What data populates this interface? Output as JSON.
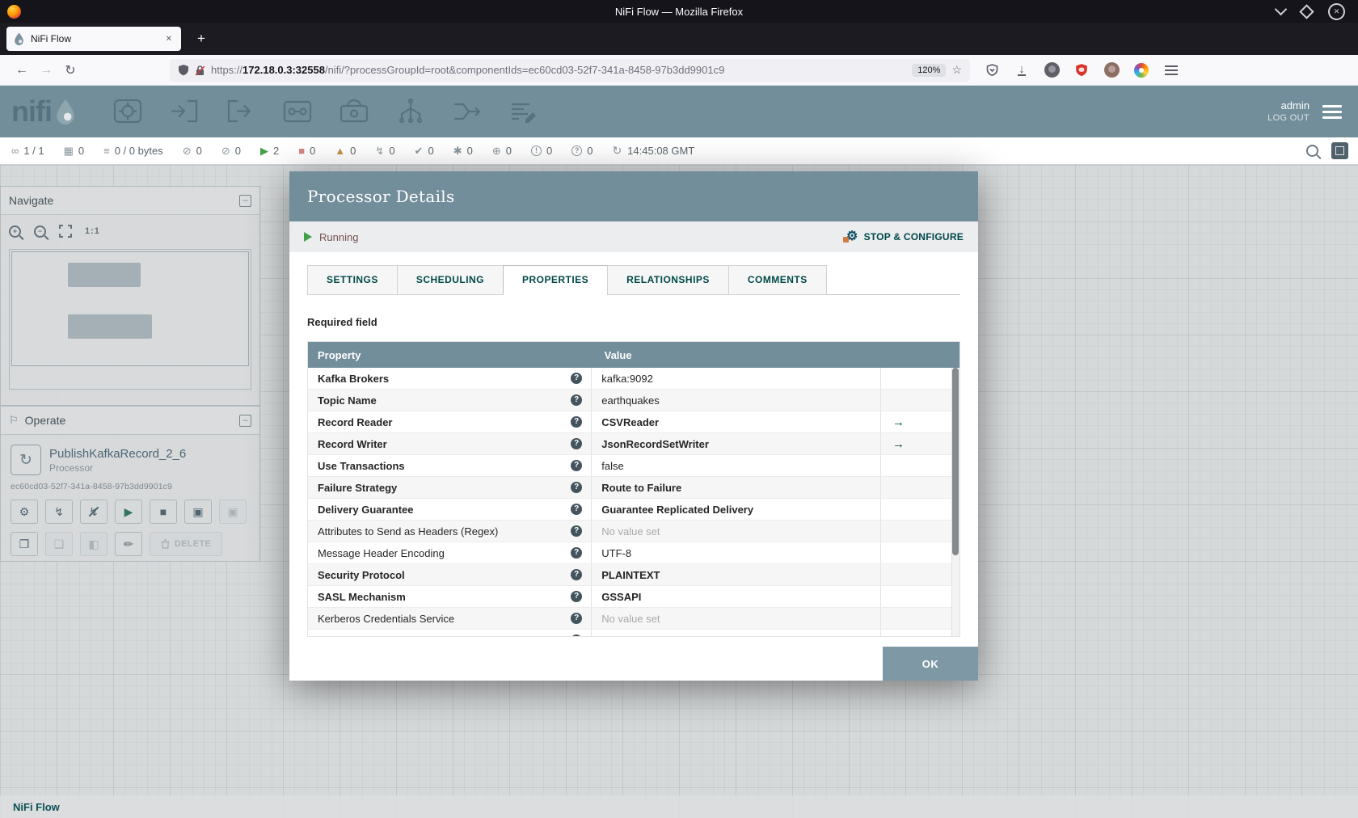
{
  "colors": {
    "nifi_header": "#728e9b",
    "primary_teal": "#004849",
    "running_green": "#43a047",
    "stopped_red": "#d18686",
    "invalid_amber": "#bf9046",
    "unset_gray": "#a9a9a9",
    "table_header": "#728e9b",
    "firefox_titlebar": "#15141a"
  },
  "titlebar": {
    "title": "NiFi Flow — Mozilla Firefox"
  },
  "tab": {
    "title": "NiFi Flow"
  },
  "navbar": {
    "url_protocol": "https://",
    "url_host": "172.18.0.3:32558",
    "url_path": "/nifi/?processGroupId=root&componentIds=ec60cd03-52f7-341a-8458-97b3dd9901c9",
    "zoom_badge": "120%"
  },
  "header": {
    "logo_text": "nifi",
    "username": "admin",
    "logout_label": "LOG OUT"
  },
  "statusbar": {
    "items": [
      {
        "icon": "cluster",
        "value": "1 / 1"
      },
      {
        "icon": "threads",
        "value": "0"
      },
      {
        "icon": "queue",
        "value": "0 / 0 bytes"
      },
      {
        "icon": "transmitting",
        "value": "0"
      },
      {
        "icon": "not-transmitting",
        "value": "0"
      },
      {
        "icon": "running",
        "value": "2"
      },
      {
        "icon": "stopped",
        "value": "0"
      },
      {
        "icon": "invalid",
        "value": "0"
      },
      {
        "icon": "disabled",
        "value": "0"
      },
      {
        "icon": "up-to-date",
        "value": "0"
      },
      {
        "icon": "locally-modified",
        "value": "0"
      },
      {
        "icon": "stale",
        "value": "0"
      },
      {
        "icon": "locally-modified-stale",
        "value": "0"
      },
      {
        "icon": "sync-failure",
        "value": "0"
      }
    ],
    "refresh_time": "14:45:08 GMT"
  },
  "navigate_panel": {
    "title": "Navigate"
  },
  "operate_panel": {
    "title": "Operate",
    "component_name": "PublishKafkaRecord_2_6",
    "component_type": "Processor",
    "component_id": "ec60cd03-52f7-341a-8458-97b3dd9901c9",
    "delete_label": "DELETE"
  },
  "breadcrumb": {
    "label": "NiFi Flow"
  },
  "dialog": {
    "title": "Processor Details",
    "status_label": "Running",
    "stop_configure_label": "STOP & CONFIGURE",
    "tabs": [
      {
        "label": "SETTINGS",
        "active": false
      },
      {
        "label": "SCHEDULING",
        "active": false
      },
      {
        "label": "PROPERTIES",
        "active": true
      },
      {
        "label": "RELATIONSHIPS",
        "active": false
      },
      {
        "label": "COMMENTS",
        "active": false
      }
    ],
    "required_field_label": "Required field",
    "table": {
      "property_header": "Property",
      "value_header": "Value",
      "rows": [
        {
          "property": "Kafka Brokers",
          "value": "kafka:9092",
          "required": true,
          "value_bold": false,
          "unset": false,
          "goto": false
        },
        {
          "property": "Topic Name",
          "value": "earthquakes",
          "required": true,
          "value_bold": false,
          "unset": false,
          "goto": false
        },
        {
          "property": "Record Reader",
          "value": "CSVReader",
          "required": true,
          "value_bold": true,
          "unset": false,
          "goto": true
        },
        {
          "property": "Record Writer",
          "value": "JsonRecordSetWriter",
          "required": true,
          "value_bold": true,
          "unset": false,
          "goto": true
        },
        {
          "property": "Use Transactions",
          "value": "false",
          "required": true,
          "value_bold": false,
          "unset": false,
          "goto": false
        },
        {
          "property": "Failure Strategy",
          "value": "Route to Failure",
          "required": true,
          "value_bold": true,
          "unset": false,
          "goto": false
        },
        {
          "property": "Delivery Guarantee",
          "value": "Guarantee Replicated Delivery",
          "required": true,
          "value_bold": true,
          "unset": false,
          "goto": false
        },
        {
          "property": "Attributes to Send as Headers (Regex)",
          "value": "No value set",
          "required": false,
          "value_bold": false,
          "unset": true,
          "goto": false
        },
        {
          "property": "Message Header Encoding",
          "value": "UTF-8",
          "required": false,
          "value_bold": false,
          "unset": false,
          "goto": false
        },
        {
          "property": "Security Protocol",
          "value": "PLAINTEXT",
          "required": true,
          "value_bold": true,
          "unset": false,
          "goto": false
        },
        {
          "property": "SASL Mechanism",
          "value": "GSSAPI",
          "required": true,
          "value_bold": true,
          "unset": false,
          "goto": false
        },
        {
          "property": "Kerberos Credentials Service",
          "value": "No value set",
          "required": false,
          "value_bold": false,
          "unset": true,
          "goto": false
        }
      ]
    },
    "ok_label": "OK"
  }
}
